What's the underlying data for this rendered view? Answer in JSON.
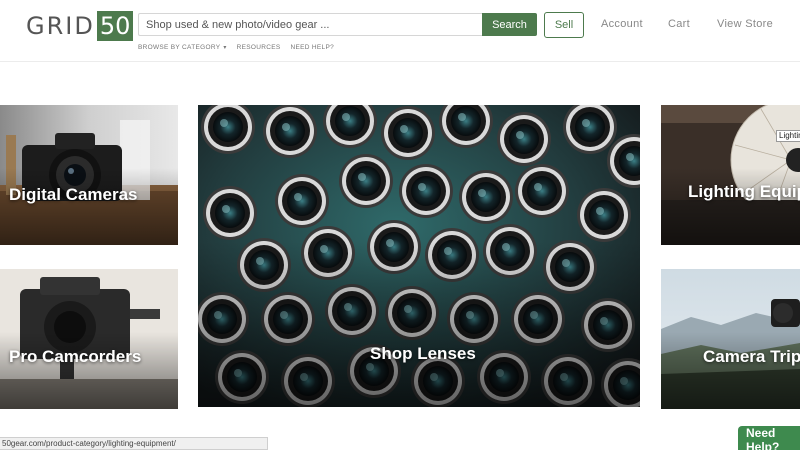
{
  "header": {
    "logo_text": "GRID",
    "logo_number": "50",
    "search": {
      "placeholder": "Shop used & new photo/video gear ...",
      "value": ""
    },
    "search_button": "Search",
    "sell_button": "Sell",
    "nav": [
      "Account",
      "Cart",
      "View Store"
    ],
    "subnav": [
      "BROWSE BY CATEGORY",
      "RESOURCES",
      "NEED HELP?"
    ]
  },
  "tiles": [
    {
      "label": "Digital Cameras"
    },
    {
      "label": "Pro Camcorders"
    },
    {
      "label": "Shop Lenses"
    },
    {
      "label": "Lighting Equipment"
    },
    {
      "label": "Camera Tripods"
    }
  ],
  "tooltip": "Lighting",
  "status_url": "50gear.com/product-category/lighting-equipment/",
  "help_button": "Need Help?",
  "colors": {
    "brand_green": "#4d7a4d",
    "help_green": "#3e8a4e"
  }
}
